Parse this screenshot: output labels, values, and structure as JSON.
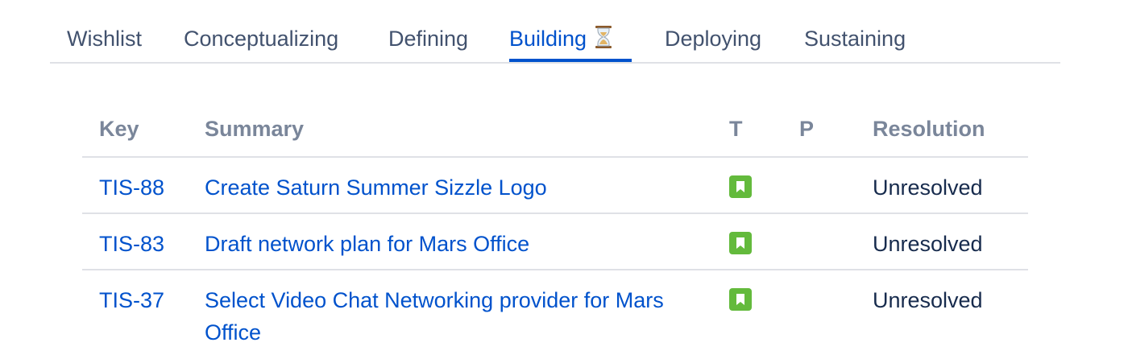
{
  "tabs": [
    {
      "label": "Wishlist",
      "active": false
    },
    {
      "label": "Conceptualizing",
      "active": false
    },
    {
      "label": "Defining",
      "active": false
    },
    {
      "label": "Building",
      "active": true,
      "icon": "hourglass-icon"
    },
    {
      "label": "Deploying",
      "active": false
    },
    {
      "label": "Sustaining",
      "active": false
    }
  ],
  "table": {
    "columns": {
      "key": "Key",
      "summary": "Summary",
      "type": "T",
      "priority": "P",
      "resolution": "Resolution"
    },
    "rows": [
      {
        "key": "TIS-88",
        "summary": "Create Saturn Summer Sizzle Logo",
        "type_icon": "story-icon",
        "priority": "",
        "resolution": "Unresolved"
      },
      {
        "key": "TIS-83",
        "summary": "Draft network plan for Mars Office",
        "type_icon": "story-icon",
        "priority": "",
        "resolution": "Unresolved"
      },
      {
        "key": "TIS-37",
        "summary": "Select Video Chat Networking provider for Mars Office",
        "type_icon": "story-icon",
        "priority": "",
        "resolution": "Unresolved"
      }
    ]
  },
  "colors": {
    "link": "#0052cc",
    "header_text": "#7a869a",
    "tab_text": "#42526e",
    "story_icon": "#63ba3c",
    "divider": "#dfe1e6"
  }
}
